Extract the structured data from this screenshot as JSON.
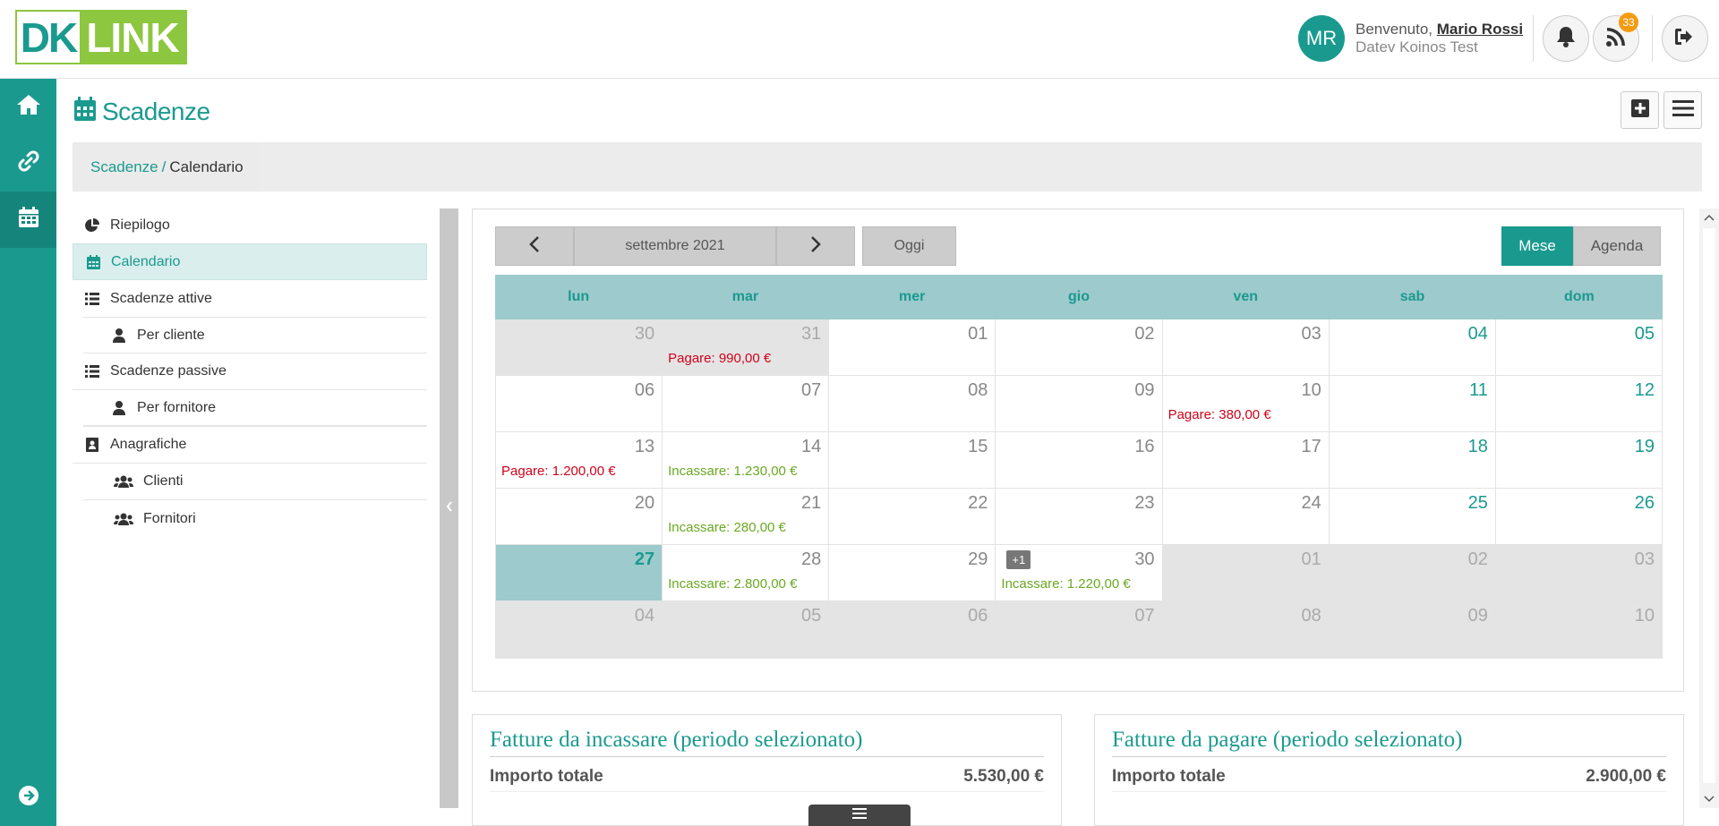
{
  "app": {
    "logo_left": "DK",
    "logo_right": "LINK"
  },
  "header": {
    "avatar_initials": "MR",
    "welcome_prefix": "Benvenuto, ",
    "user_name": "Mario Rossi",
    "company": "Datev Koinos Test",
    "notifications_badge": "33",
    "icons": [
      "bell-icon",
      "rss-icon",
      "logout-icon"
    ]
  },
  "rail": {
    "items": [
      "home-icon",
      "link-icon",
      "calendar-icon"
    ],
    "bottom": "arrow-right-circle-icon",
    "accent": "#1a9a8f"
  },
  "page": {
    "title": "Scadenze",
    "actions": [
      "plus-square-icon",
      "hamburger-menu-icon"
    ]
  },
  "breadcrumb": {
    "link": "Scadenze",
    "separator": "/",
    "current": "Calendario"
  },
  "menu": {
    "items": [
      {
        "label": "Riepilogo",
        "icon": "pie-chart-icon"
      },
      {
        "label": "Calendario",
        "icon": "calendar-icon"
      },
      {
        "label": "Scadenze attive",
        "icon": "list-icon"
      },
      {
        "label": "Per cliente",
        "icon": "user-icon"
      },
      {
        "label": "Scadenze passive",
        "icon": "list-icon"
      },
      {
        "label": "Per fornitore",
        "icon": "user-icon"
      },
      {
        "label": "Anagrafiche",
        "icon": "address-book-icon"
      },
      {
        "label": "Clienti",
        "icon": "users-icon"
      },
      {
        "label": "Fornitori",
        "icon": "users-icon"
      }
    ],
    "active": "Calendario"
  },
  "calendar": {
    "month_label": "settembre 2021",
    "today_label": "Oggi",
    "view_month": "Mese",
    "view_agenda": "Agenda",
    "weekdays": [
      "lun",
      "mar",
      "mer",
      "gio",
      "ven",
      "sab",
      "dom"
    ],
    "weeks": [
      [
        {
          "d": "30",
          "out": true
        },
        {
          "d": "31",
          "out": true,
          "event": "Pagare: 990,00 €",
          "type": "pay"
        },
        {
          "d": "01"
        },
        {
          "d": "02"
        },
        {
          "d": "03"
        },
        {
          "d": "04",
          "weekend": true
        },
        {
          "d": "05",
          "weekend": true
        }
      ],
      [
        {
          "d": "06"
        },
        {
          "d": "07"
        },
        {
          "d": "08"
        },
        {
          "d": "09"
        },
        {
          "d": "10",
          "event": "Pagare: 380,00 €",
          "type": "pay"
        },
        {
          "d": "11",
          "weekend": true
        },
        {
          "d": "12",
          "weekend": true
        }
      ],
      [
        {
          "d": "13",
          "event": "Pagare: 1.200,00 €",
          "type": "pay"
        },
        {
          "d": "14",
          "event": "Incassare: 1.230,00 €",
          "type": "collect"
        },
        {
          "d": "15"
        },
        {
          "d": "16"
        },
        {
          "d": "17"
        },
        {
          "d": "18",
          "weekend": true
        },
        {
          "d": "19",
          "weekend": true
        }
      ],
      [
        {
          "d": "20"
        },
        {
          "d": "21",
          "event": "Incassare: 280,00 €",
          "type": "collect"
        },
        {
          "d": "22"
        },
        {
          "d": "23"
        },
        {
          "d": "24"
        },
        {
          "d": "25",
          "weekend": true
        },
        {
          "d": "26",
          "weekend": true
        }
      ],
      [
        {
          "d": "27",
          "today": true
        },
        {
          "d": "28",
          "event": "Incassare: 2.800,00 €",
          "type": "collect"
        },
        {
          "d": "29"
        },
        {
          "d": "30",
          "event": "Incassare: 1.220,00 €",
          "type": "collect",
          "more": "+1"
        },
        {
          "d": "01",
          "out": true
        },
        {
          "d": "02",
          "out": true
        },
        {
          "d": "03",
          "out": true
        }
      ],
      [
        {
          "d": "04",
          "out": true
        },
        {
          "d": "05",
          "out": true
        },
        {
          "d": "06",
          "out": true
        },
        {
          "d": "07",
          "out": true
        },
        {
          "d": "08",
          "out": true
        },
        {
          "d": "09",
          "out": true
        },
        {
          "d": "10",
          "out": true
        }
      ]
    ]
  },
  "summary": {
    "incassare": {
      "title": "Fatture da incassare (periodo selezionato)",
      "label": "Importo totale",
      "value": "5.530,00 €"
    },
    "pagare": {
      "title": "Fatture da pagare (periodo selezionato)",
      "label": "Importo totale",
      "value": "2.900,00 €"
    }
  },
  "colors": {
    "primary": "#1a9a8f",
    "pay": "#d0021b",
    "collect": "#6aa822",
    "badge": "#f39c12"
  }
}
